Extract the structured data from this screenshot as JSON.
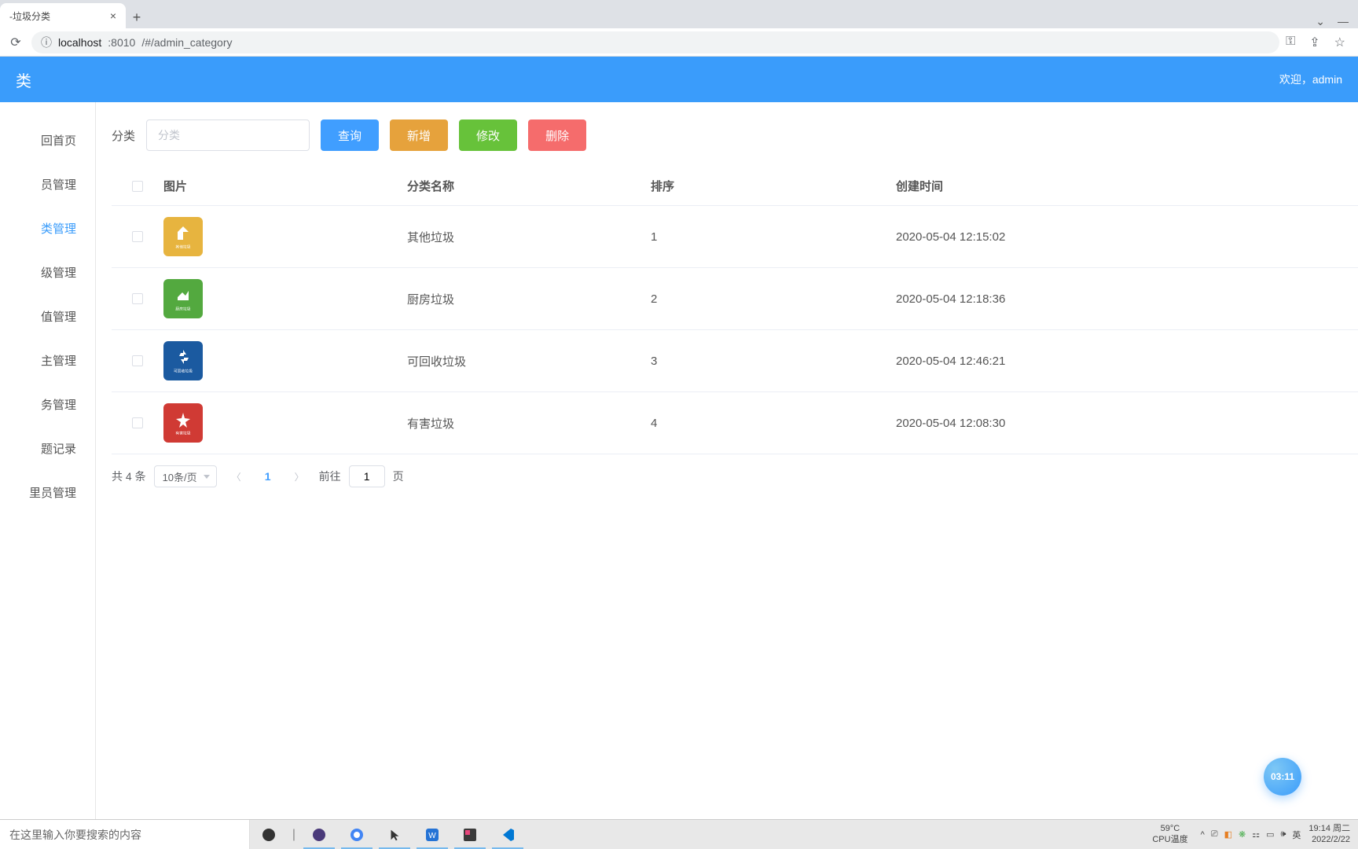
{
  "browser": {
    "tab_title": "-垃圾分类",
    "url_host": "localhost",
    "url_port": ":8010",
    "url_path": "/#/admin_category"
  },
  "header": {
    "title": "类",
    "welcome": "欢迎，admin"
  },
  "sidebar": {
    "items": [
      {
        "label": "回首页",
        "active": false
      },
      {
        "label": "员管理",
        "active": false
      },
      {
        "label": "类管理",
        "active": true
      },
      {
        "label": "级管理",
        "active": false
      },
      {
        "label": "值管理",
        "active": false
      },
      {
        "label": "主管理",
        "active": false
      },
      {
        "label": "务管理",
        "active": false
      },
      {
        "label": "题记录",
        "active": false
      },
      {
        "label": "里员管理",
        "active": false
      }
    ]
  },
  "toolbar": {
    "label": "分类",
    "placeholder": "分类",
    "btn_query": "查询",
    "btn_add": "新增",
    "btn_edit": "修改",
    "btn_delete": "删除"
  },
  "table": {
    "headers": {
      "img": "图片",
      "name": "分类名称",
      "sort": "排序",
      "time": "创建时间"
    },
    "rows": [
      {
        "color": "#e7b43f",
        "name": "其他垃圾",
        "sort": "1",
        "time": "2020-05-04 12:15:02",
        "icon": "other"
      },
      {
        "color": "#53a93f",
        "name": "厨房垃圾",
        "sort": "2",
        "time": "2020-05-04 12:18:36",
        "icon": "kitchen"
      },
      {
        "color": "#1b5aa0",
        "name": "可回收垃圾",
        "sort": "3",
        "time": "2020-05-04 12:46:21",
        "icon": "recycle"
      },
      {
        "color": "#d03a34",
        "name": "有害垃圾",
        "sort": "4",
        "time": "2020-05-04 12:08:30",
        "icon": "hazard"
      }
    ]
  },
  "pagination": {
    "total": "共 4 条",
    "page_size": "10条/页",
    "current": "1",
    "goto_label": "前往",
    "goto_value": "1",
    "goto_suffix": "页"
  },
  "float_badge": "03:11",
  "taskbar": {
    "search_placeholder": "在这里输入你要搜索的内容",
    "weather_temp": "59°C",
    "weather_label": "CPU温度",
    "ime": "英",
    "time": "19:14 周二",
    "date": "2022/2/22"
  }
}
